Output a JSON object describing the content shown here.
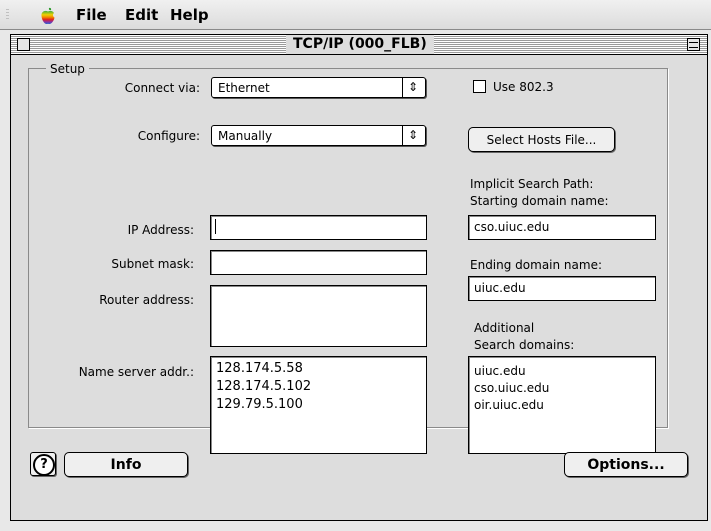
{
  "menubar": {
    "items": [
      "File",
      "Edit",
      "Help"
    ]
  },
  "window": {
    "title": "TCP/IP (000_FLB)"
  },
  "connect": {
    "label": "Connect via:",
    "value": "Ethernet",
    "use8023_label": "Use 802.3",
    "use8023_checked": false
  },
  "setup": {
    "group_label": "Setup",
    "configure_label": "Configure:",
    "configure_value": "Manually",
    "select_hosts_label": "Select Hosts File...",
    "ip_label": "IP Address:",
    "ip_value": "",
    "subnet_label": "Subnet mask:",
    "subnet_value": "",
    "router_label": "Router address:",
    "router_value": "",
    "nameserver_label": "Name server addr.:",
    "nameservers": [
      "128.174.5.58",
      "128.174.5.102",
      "129.79.5.100"
    ],
    "implicit_label_1": "Implicit Search Path:",
    "implicit_label_2": "Starting domain name:",
    "starting_domain": "cso.uiuc.edu",
    "ending_label": "Ending domain name:",
    "ending_domain": "uiuc.edu",
    "additional_label_1": "Additional",
    "additional_label_2": "Search domains:",
    "search_domains": [
      "uiuc.edu",
      "cso.uiuc.edu",
      "oir.uiuc.edu"
    ]
  },
  "footer": {
    "help_glyph": "?",
    "info_label": "Info",
    "options_label": "Options..."
  },
  "icons": {
    "popup_arrow": "⇕"
  }
}
